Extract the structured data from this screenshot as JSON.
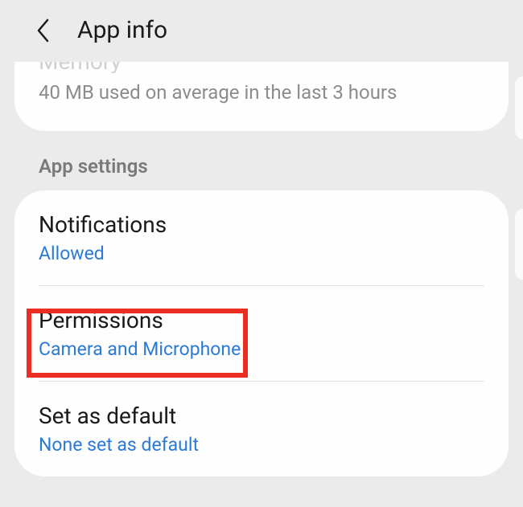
{
  "header": {
    "title": "App info"
  },
  "memory": {
    "title": "Memory",
    "subtitle": "40 MB used on average in the last 3 hours"
  },
  "section": {
    "header": "App settings"
  },
  "rows": {
    "notifications": {
      "title": "Notifications",
      "subtitle": "Allowed"
    },
    "permissions": {
      "title": "Permissions",
      "subtitle": "Camera and Microphone"
    },
    "setdefault": {
      "title": "Set as default",
      "subtitle": "None set as default"
    }
  }
}
